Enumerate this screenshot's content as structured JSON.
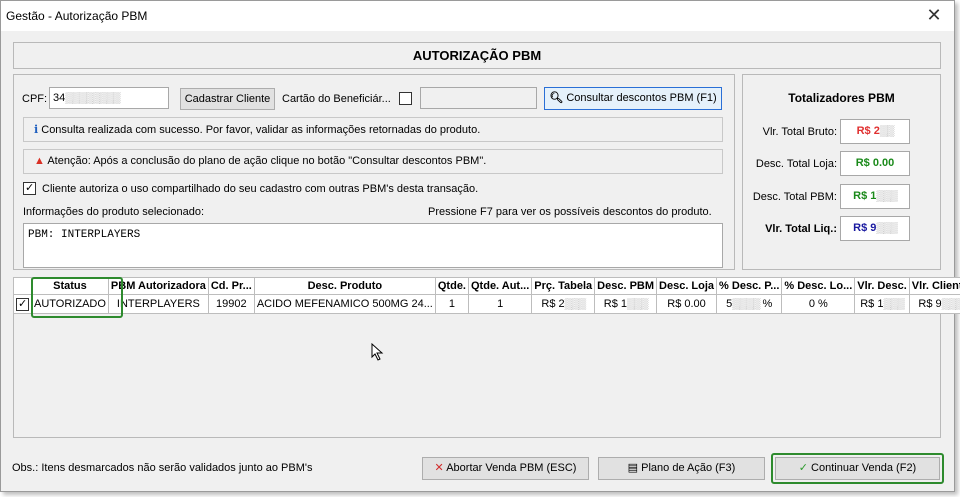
{
  "window": {
    "title": "Gestão - Autorização PBM",
    "close_glyph": "✕"
  },
  "header": {
    "title": "AUTORIZAÇÃO PBM"
  },
  "form": {
    "cpf_label": "CPF:",
    "cpf_value": "34",
    "cadastrar_label": "Cadastrar Cliente",
    "cartao_label": "Cartão do Beneficiár...",
    "cartao_value": "",
    "consultar_label": "Consultar descontos PBM (F1)",
    "info_message": "Consulta realizada com sucesso. Por favor, validar as informações retornadas do produto.",
    "warning_message": "Atenção: Após a conclusão do plano de ação clique no botão \"Consultar descontos PBM\".",
    "consent_label": "Cliente autoriza o uso compartilhado do seu cadastro com outras PBM's desta transação.",
    "consent_checked": true,
    "product_info_label": "Informações do produto selecionado:",
    "f7_hint": "Pressione F7 para ver os possíveis descontos do produto.",
    "product_info_text": "PBM: INTERPLAYERS"
  },
  "totals": {
    "title": "Totalizadores PBM",
    "bruto_label": "Vlr. Total Bruto:",
    "bruto_value": "R$ 2",
    "loja_label": "Desc. Total Loja:",
    "loja_value": "R$ 0.00",
    "pbm_label": "Desc. Total PBM:",
    "pbm_value": "R$ 1",
    "liq_label": "Vlr. Total Liq.:",
    "liq_value": "R$ 9",
    "colors": {
      "red": "#e03030",
      "green": "#1a8a1a",
      "blue": "#1a1aa0"
    }
  },
  "table": {
    "headers": [
      "",
      "Status",
      "PBM Autorizadora",
      "Cd. Pr...",
      "Desc. Produto",
      "Qtde.",
      "Qtde. Aut...",
      "Prç. Tabela",
      "Desc. PBM",
      "Desc. Loja",
      "% Desc. P...",
      "% Desc. Lo...",
      "Vlr. Desc.",
      "Vlr. Cliente"
    ],
    "rows": [
      [
        "✓",
        "AUTORIZADO",
        "INTERPLAYERS",
        "19902",
        "ACIDO MEFENAMICO 500MG 24...",
        "1",
        "1",
        "R$ 2",
        "R$ 1",
        "R$ 0.00",
        "5",
        "0 %",
        "R$ 1",
        "R$ 9"
      ]
    ],
    "percent_suffix": "%"
  },
  "footer": {
    "obs": "Obs.: Itens desmarcados não serão validados junto ao PBM's",
    "abortar_label": "Abortar Venda PBM (ESC)",
    "plano_label": "Plano de Ação (F3)",
    "continuar_label": "Continuar Venda (F2)"
  },
  "accent_green": "#2e8b2e"
}
